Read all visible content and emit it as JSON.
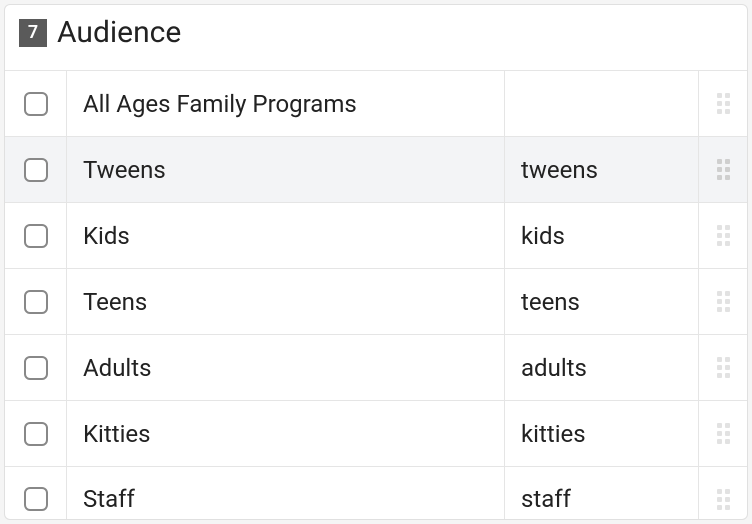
{
  "header": {
    "count": "7",
    "title": "Audience"
  },
  "rows": [
    {
      "label": "All Ages Family Programs",
      "slug": "",
      "hovered": false
    },
    {
      "label": "Tweens",
      "slug": "tweens",
      "hovered": true
    },
    {
      "label": "Kids",
      "slug": "kids",
      "hovered": false
    },
    {
      "label": "Teens",
      "slug": "teens",
      "hovered": false
    },
    {
      "label": "Adults",
      "slug": "adults",
      "hovered": false
    },
    {
      "label": "Kitties",
      "slug": "kitties",
      "hovered": false
    },
    {
      "label": "Staff",
      "slug": "staff",
      "hovered": false
    }
  ]
}
